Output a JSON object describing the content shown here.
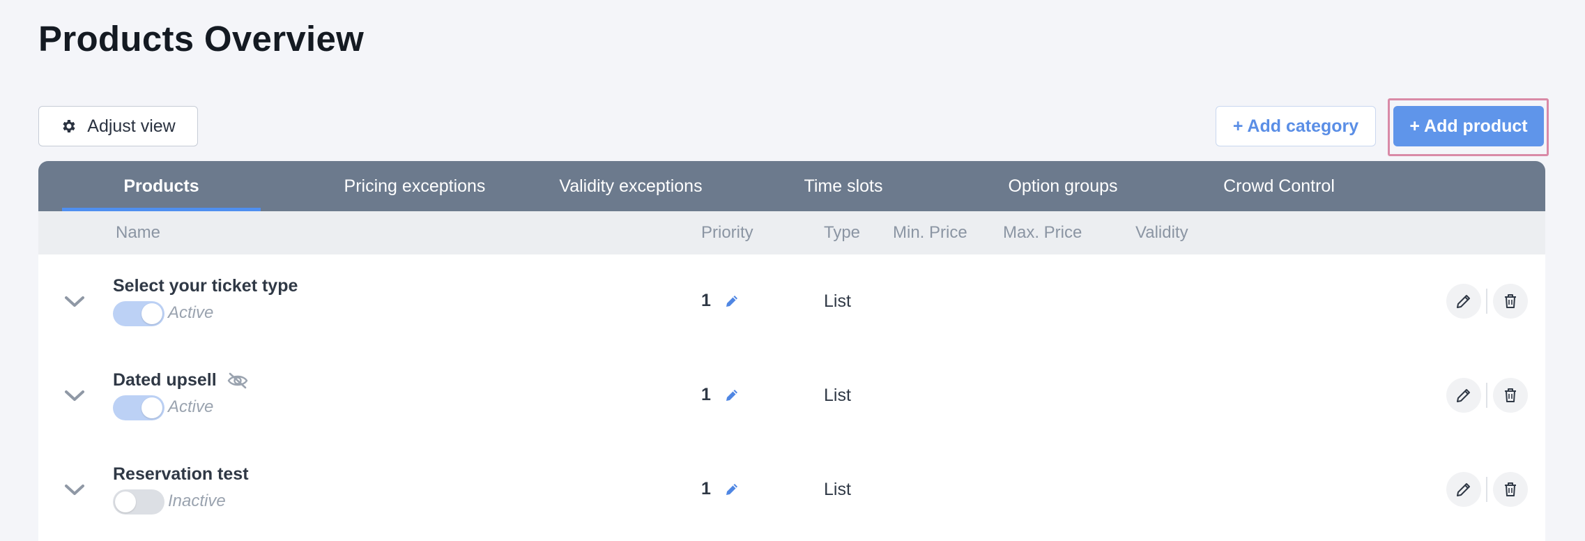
{
  "page": {
    "title": "Products Overview"
  },
  "toolbar": {
    "adjust_view_label": "Adjust view",
    "add_category_label": "+ Add category",
    "add_product_label": "+ Add product"
  },
  "tabs": [
    {
      "label": "Products",
      "active": true
    },
    {
      "label": "Pricing exceptions",
      "active": false
    },
    {
      "label": "Validity exceptions",
      "active": false
    },
    {
      "label": "Time slots",
      "active": false
    },
    {
      "label": "Option groups",
      "active": false
    },
    {
      "label": "Crowd Control",
      "active": false
    }
  ],
  "columns": {
    "name": "Name",
    "priority": "Priority",
    "type": "Type",
    "min_price": "Min. Price",
    "max_price": "Max. Price",
    "validity": "Validity"
  },
  "rows": [
    {
      "name": "Select your ticket type",
      "status": "Active",
      "active": true,
      "hidden": false,
      "priority": "1",
      "type": "List"
    },
    {
      "name": "Dated upsell",
      "status": "Active",
      "active": true,
      "hidden": true,
      "priority": "1",
      "type": "List"
    },
    {
      "name": "Reservation test",
      "status": "Inactive",
      "active": false,
      "hidden": false,
      "priority": "1",
      "type": "List"
    }
  ],
  "icons": {
    "adjust_view": "gear-icon",
    "row_expand": "chevron-down-icon",
    "hidden": "eye-slash-icon",
    "priority_edit": "pencil-icon",
    "row_edit": "pencil-icon",
    "row_delete": "trash-icon"
  },
  "colors": {
    "accent": "#5f95ea",
    "tab_bar": "#6c7a8d",
    "tab_indicator": "#4f8ff0",
    "highlight": "#d98aa7",
    "toggle_on": "#bcd1f5",
    "toggle_off": "#dcdfe4"
  }
}
